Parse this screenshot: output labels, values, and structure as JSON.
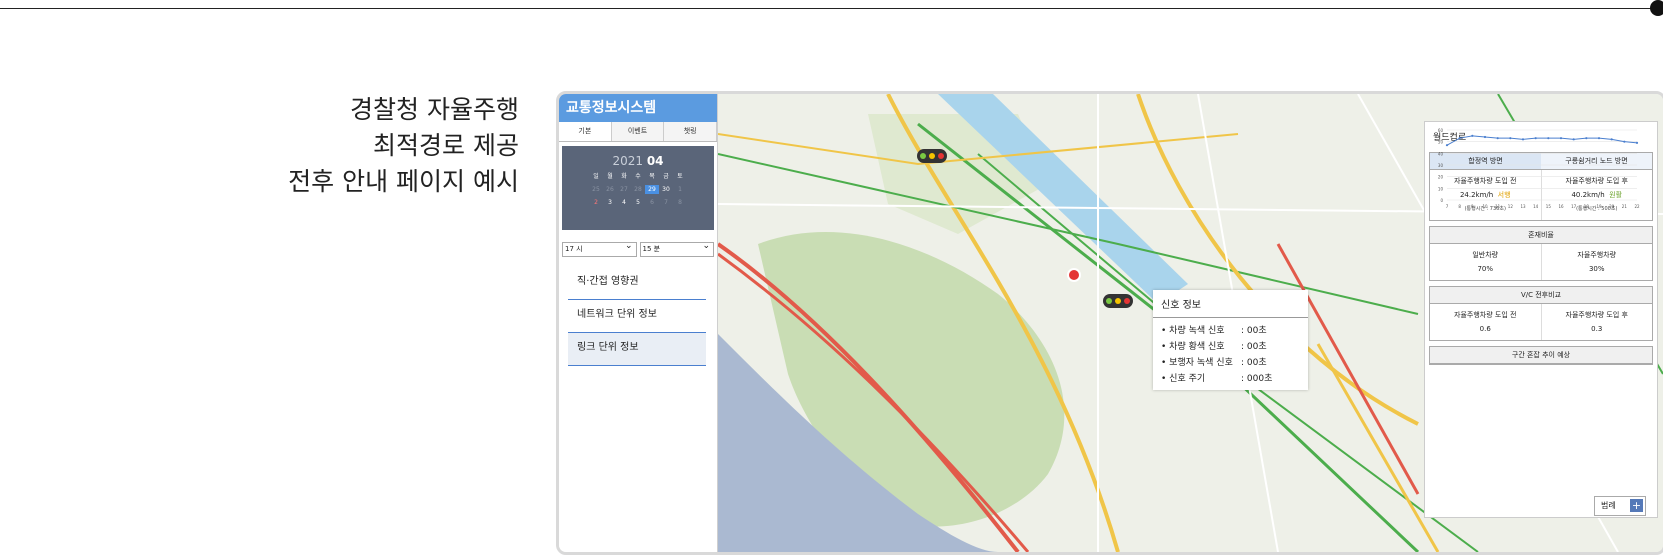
{
  "headline": [
    "경찰청 자율주행",
    "최적경로 제공",
    "전후 안내 페이지 예시"
  ],
  "sidebar": {
    "title": "교통정보시스템",
    "tabs": [
      "기본",
      "이벤트",
      "챗링"
    ],
    "calendar": {
      "year": "2021",
      "month": "04",
      "weekdays": [
        "일",
        "월",
        "화",
        "수",
        "목",
        "금",
        "토"
      ],
      "week1": [
        "25",
        "26",
        "27",
        "28",
        "29",
        "30",
        "1"
      ],
      "week2": [
        "2",
        "3",
        "4",
        "5",
        "6",
        "7",
        "8"
      ]
    },
    "hour_select": "17 시",
    "minute_select": "15 분",
    "menu": [
      "직·간접 영향권",
      "네트워크 단위 정보",
      "링크 단위 정보"
    ]
  },
  "signal_info": {
    "title": "신호 정보",
    "rows": [
      {
        "label": "차량 녹색 신호",
        "value": ": 00초"
      },
      {
        "label": "차량 황색 신호",
        "value": ": 00초"
      },
      {
        "label": "보행자 녹색 신호",
        "value": ": 00초"
      },
      {
        "label": "신호 주기",
        "value": ": 000초"
      }
    ]
  },
  "right_panel": {
    "title": "월드컵로",
    "direction_a": "합정역 방면",
    "direction_b": "구룡쉼거리 노드 방면",
    "before_label": "자율주행차량 도입 전",
    "after_label": "자율주행차량 도입 후",
    "speed_before": "24.2km/h",
    "speed_before_status": "서행",
    "speed_after": "40.2km/h",
    "speed_after_status": "원활",
    "time_before": "(통행시간 : 736초)",
    "time_after": "(통행시간 : 500초)",
    "mix_title": "혼재비율",
    "normal_label": "일반차량",
    "normal_value": "70%",
    "auto_label": "자율주행차량",
    "auto_value": "30%",
    "vc_title": "V/C 전후비교",
    "vc_before_label": "자율주행차량 도입 전",
    "vc_before": "0.6",
    "vc_after_label": "자율주행차량 도입 후",
    "vc_after": "0.3",
    "chart_title": "구간 혼잡 추이 예상",
    "legend_label": "범례",
    "plus_label": "+"
  },
  "chart_data": {
    "type": "line",
    "title": "구간 혼잡 추이 예상",
    "categories": [
      "7",
      "8",
      "9",
      "10",
      "11",
      "12",
      "13",
      "14",
      "15",
      "16",
      "17",
      "18",
      "19",
      "20",
      "21",
      "22"
    ],
    "y_ticks": [
      "0",
      "10",
      "20",
      "30",
      "40",
      "50",
      "60"
    ],
    "ylim": [
      0,
      60
    ],
    "series": [
      {
        "values": [
          47,
          53,
          55,
          54,
          53,
          53,
          52,
          53,
          53,
          53,
          52,
          53,
          53,
          52,
          50,
          49
        ]
      }
    ]
  },
  "colors": {
    "accent": "#5b9be0",
    "calendar_bg": "#5a6579",
    "line": "#4a7fcf",
    "signal_red": "#e43434"
  }
}
